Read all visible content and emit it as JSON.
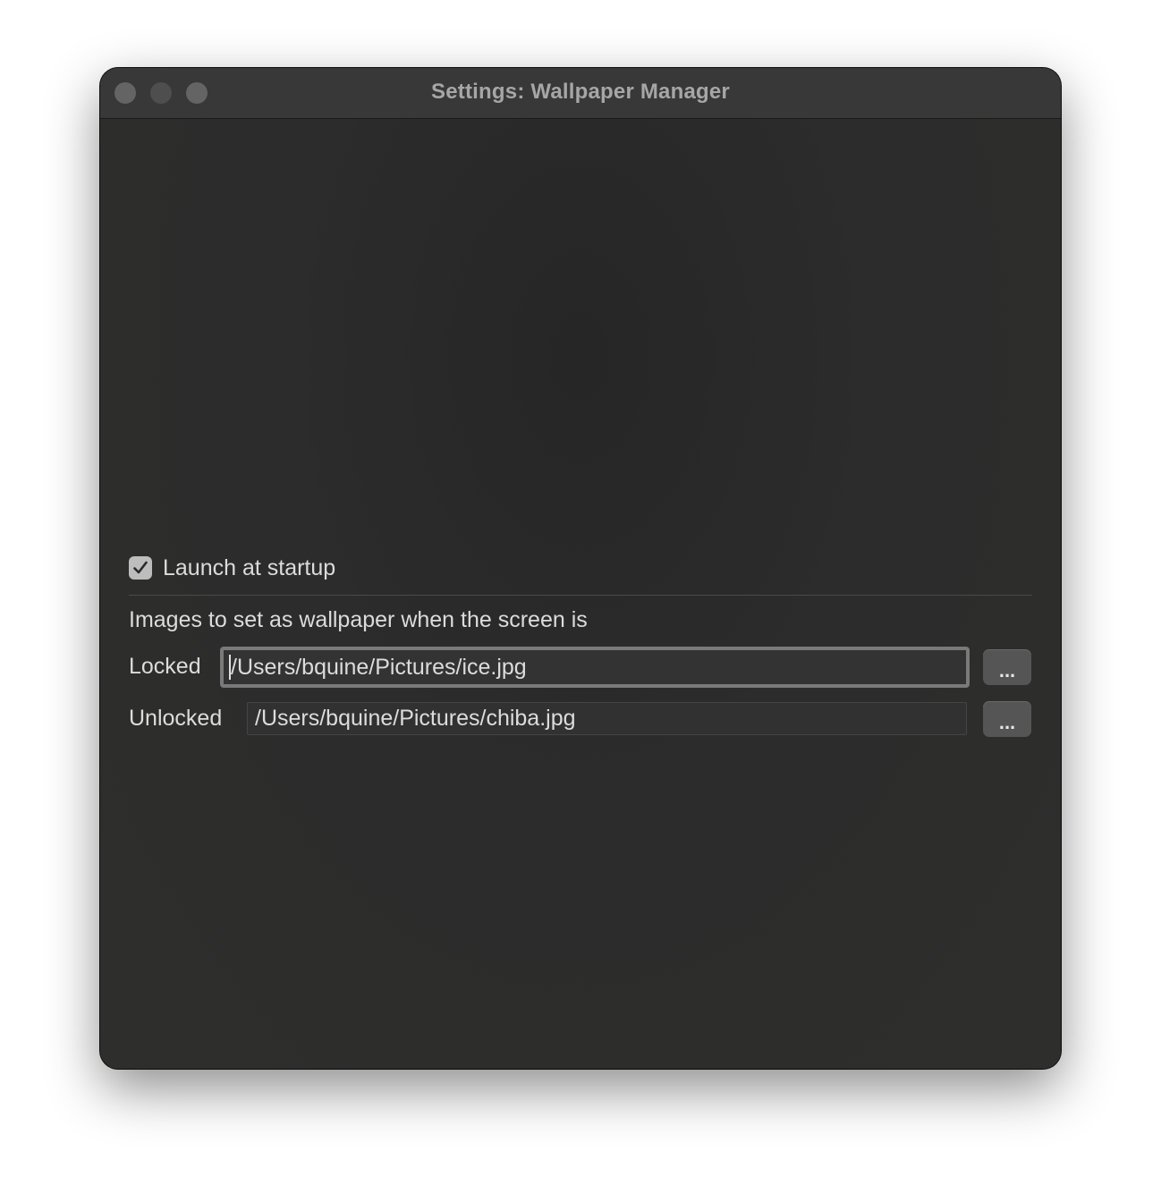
{
  "window": {
    "title": "Settings: Wallpaper Manager"
  },
  "settings": {
    "launch_at_startup": {
      "label": "Launch at startup",
      "checked": true
    },
    "section_label": "Images to set as wallpaper when the screen is",
    "locked": {
      "label": "Locked",
      "value": "/Users/bquine/Pictures/ice.jpg",
      "browse_label": "..."
    },
    "unlocked": {
      "label": "Unlocked",
      "value": "/Users/bquine/Pictures/chiba.jpg",
      "browse_label": "..."
    }
  },
  "icons": {
    "checkbox": "checkmark-icon"
  },
  "colors": {
    "window_background": "#2b2b2b",
    "titlebar": "#383838",
    "text": "#dcdcdc",
    "button": "#555555",
    "focus_ring": "#7a7a7a"
  }
}
